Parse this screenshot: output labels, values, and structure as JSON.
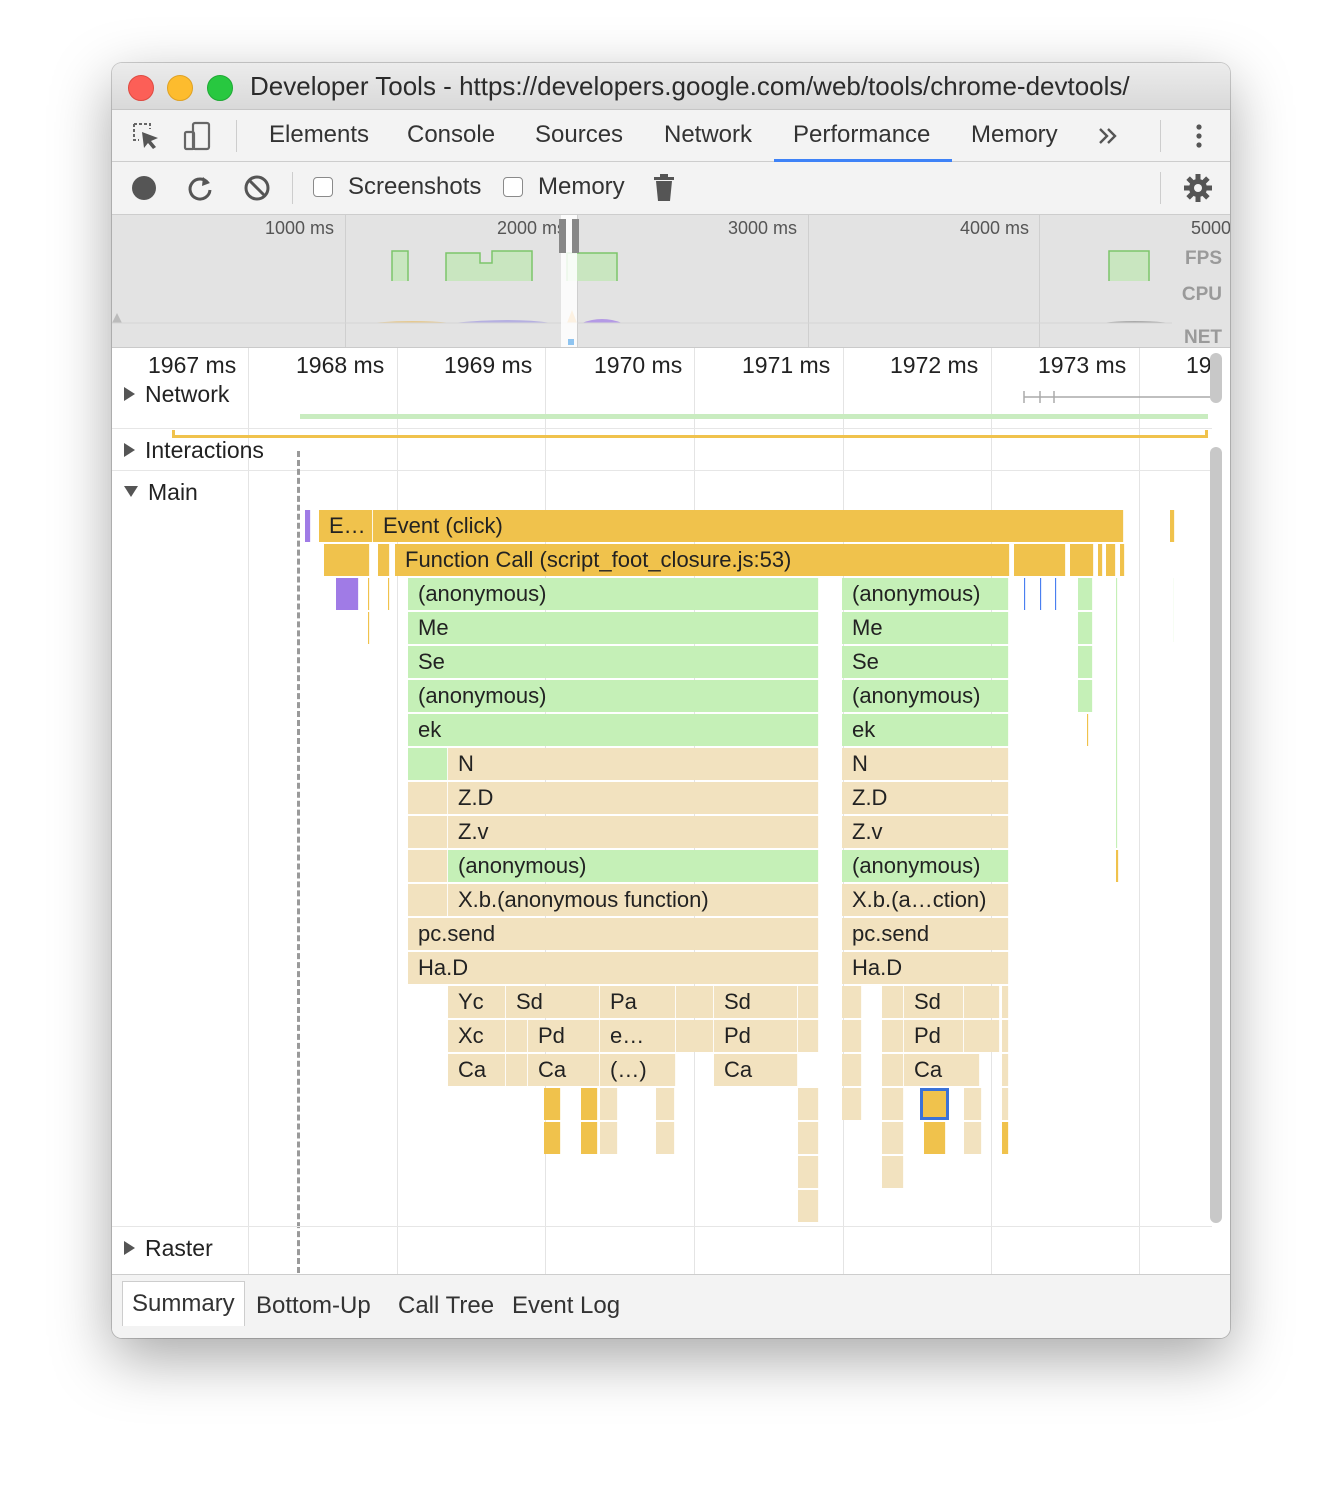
{
  "window": {
    "title": "Developer Tools - https://developers.google.com/web/tools/chrome-devtools/"
  },
  "panel_tabs": [
    {
      "label": "Elements"
    },
    {
      "label": "Console"
    },
    {
      "label": "Sources"
    },
    {
      "label": "Network"
    },
    {
      "label": "Performance",
      "active": true
    },
    {
      "label": "Memory"
    }
  ],
  "toolbar": {
    "screenshots_label": "Screenshots",
    "screenshots_checked": false,
    "memory_label": "Memory",
    "memory_checked": false
  },
  "overview": {
    "ticks": [
      "1000 ms",
      "2000 ms",
      "3000 ms",
      "4000 ms",
      "5000"
    ],
    "labels": {
      "fps": "FPS",
      "cpu": "CPU",
      "net": "NET"
    }
  },
  "ruler": {
    "ticks": [
      "1967 ms",
      "1968 ms",
      "1969 ms",
      "1970 ms",
      "1971 ms",
      "1972 ms",
      "1973 ms",
      "19"
    ]
  },
  "tracks": {
    "network": "Network",
    "interactions": "Interactions",
    "main": "Main",
    "raster": "Raster"
  },
  "flame": {
    "event_short": "E…",
    "event_click": "Event (click)",
    "function_call": "Function Call (script_foot_closure.js:53)",
    "left_stack": [
      "(anonymous)",
      "Me",
      "Se",
      "(anonymous)",
      "ek",
      "N",
      "Z.D",
      "Z.v",
      "(anonymous)",
      "X.b.(anonymous function)",
      "pc.send",
      "Ha.D"
    ],
    "right_stack": [
      "(anonymous)",
      "Me",
      "Se",
      "(anonymous)",
      "ek",
      "N",
      "Z.D",
      "Z.v",
      "(anonymous)",
      "X.b.(a…ction)",
      "pc.send",
      "Ha.D"
    ],
    "left_row1": [
      "Yc",
      "Sd",
      "Pa",
      "Sd"
    ],
    "left_row2": [
      "Xc",
      "Pd",
      "e…",
      "Pd"
    ],
    "left_row3": [
      "Ca",
      "Ca",
      "(…)",
      "Ca"
    ],
    "right_row1": "Sd",
    "right_row2": "Pd",
    "right_row3": "Ca"
  },
  "bottom_tabs": [
    "Summary",
    "Bottom-Up",
    "Call Tree",
    "Event Log"
  ],
  "colors": {
    "scripting": "#f0c24c",
    "js_frame_green": "#c5f0b7",
    "js_frame_tan": "#f2e2bf",
    "rendering": "#a07be6",
    "accent": "#3e82f7"
  }
}
